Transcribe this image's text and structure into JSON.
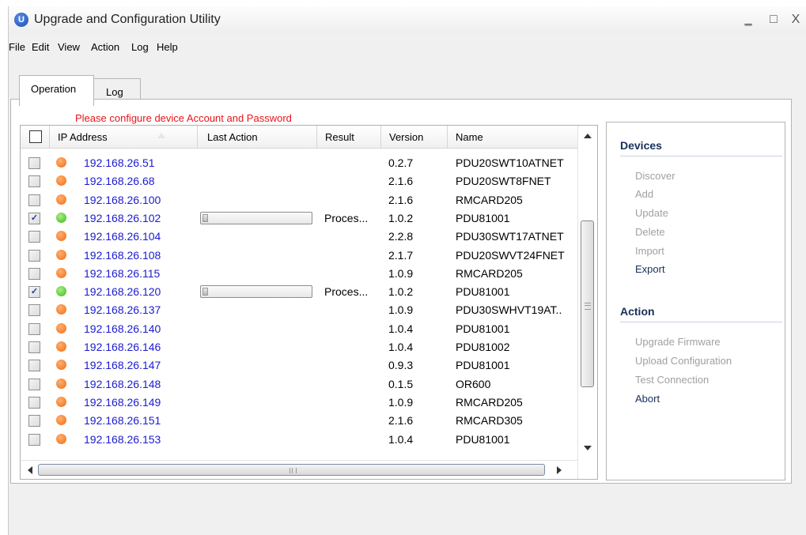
{
  "window": {
    "title": "Upgrade and Configuration Utility",
    "app_icon": "U",
    "controls": [
      "minimize-icon",
      "maximize-icon",
      "close-icon"
    ],
    "minimize_glyph": "‗",
    "maximize_glyph": "□",
    "close_glyph": "X"
  },
  "menu": [
    "File",
    "Edit",
    "View",
    "Action",
    "Log",
    "Help"
  ],
  "tabs": [
    {
      "label": "Operation",
      "active": true
    },
    {
      "label": "Log",
      "active": false
    }
  ],
  "warning": "Please configure device Account and Password",
  "columns": [
    "IP Address",
    "Last Action",
    "Result",
    "Version",
    "Name"
  ],
  "rows": [
    {
      "checked": false,
      "status": "orange",
      "ip": "192.168.26.51",
      "progress": null,
      "result": "",
      "version": "0.2.7",
      "name": "PDU20SWT10ATNET"
    },
    {
      "checked": false,
      "status": "orange",
      "ip": "192.168.26.68",
      "progress": null,
      "result": "",
      "version": "2.1.6",
      "name": "PDU20SWT8FNET"
    },
    {
      "checked": false,
      "status": "orange",
      "ip": "192.168.26.100",
      "progress": null,
      "result": "",
      "version": "2.1.6",
      "name": "RMCARD205"
    },
    {
      "checked": true,
      "status": "green",
      "ip": "192.168.26.102",
      "progress": 0.05,
      "result": "Proces...",
      "version": "1.0.2",
      "name": "PDU81001"
    },
    {
      "checked": false,
      "status": "orange",
      "ip": "192.168.26.104",
      "progress": null,
      "result": "",
      "version": "2.2.8",
      "name": "PDU30SWT17ATNET"
    },
    {
      "checked": false,
      "status": "orange",
      "ip": "192.168.26.108",
      "progress": null,
      "result": "",
      "version": "2.1.7",
      "name": "PDU20SWVT24FNET"
    },
    {
      "checked": false,
      "status": "orange",
      "ip": "192.168.26.115",
      "progress": null,
      "result": "",
      "version": "1.0.9",
      "name": "RMCARD205"
    },
    {
      "checked": true,
      "status": "green",
      "ip": "192.168.26.120",
      "progress": 0.05,
      "result": "Proces...",
      "version": "1.0.2",
      "name": "PDU81001"
    },
    {
      "checked": false,
      "status": "orange",
      "ip": "192.168.26.137",
      "progress": null,
      "result": "",
      "version": "1.0.9",
      "name": "PDU30SWHVT19AT.."
    },
    {
      "checked": false,
      "status": "orange",
      "ip": "192.168.26.140",
      "progress": null,
      "result": "",
      "version": "1.0.4",
      "name": "PDU81001"
    },
    {
      "checked": false,
      "status": "orange",
      "ip": "192.168.26.146",
      "progress": null,
      "result": "",
      "version": "1.0.4",
      "name": "PDU81002"
    },
    {
      "checked": false,
      "status": "orange",
      "ip": "192.168.26.147",
      "progress": null,
      "result": "",
      "version": "0.9.3",
      "name": "PDU81001"
    },
    {
      "checked": false,
      "status": "orange",
      "ip": "192.168.26.148",
      "progress": null,
      "result": "",
      "version": "0.1.5",
      "name": "OR600"
    },
    {
      "checked": false,
      "status": "orange",
      "ip": "192.168.26.149",
      "progress": null,
      "result": "",
      "version": "1.0.9",
      "name": "RMCARD205"
    },
    {
      "checked": false,
      "status": "orange",
      "ip": "192.168.26.151",
      "progress": null,
      "result": "",
      "version": "2.1.6",
      "name": "RMCARD305"
    },
    {
      "checked": false,
      "status": "orange",
      "ip": "192.168.26.153",
      "progress": null,
      "result": "",
      "version": "1.0.4",
      "name": "PDU81001"
    }
  ],
  "check_glyph": "✓",
  "status_colors": {
    "orange": "#f26b10",
    "green": "#3cb81e"
  },
  "sidebar": {
    "devices_title": "Devices",
    "devices": [
      {
        "label": "Discover",
        "enabled": false
      },
      {
        "label": "Add",
        "enabled": false
      },
      {
        "label": "Update",
        "enabled": false
      },
      {
        "label": "Delete",
        "enabled": false
      },
      {
        "label": "Import",
        "enabled": false
      },
      {
        "label": "Export",
        "enabled": true
      }
    ],
    "action_title": "Action",
    "actions": [
      {
        "label": "Upgrade Firmware",
        "enabled": false
      },
      {
        "label": "Upload Configuration",
        "enabled": false
      },
      {
        "label": "Test Connection",
        "enabled": false
      },
      {
        "label": "Abort",
        "enabled": true
      }
    ]
  }
}
